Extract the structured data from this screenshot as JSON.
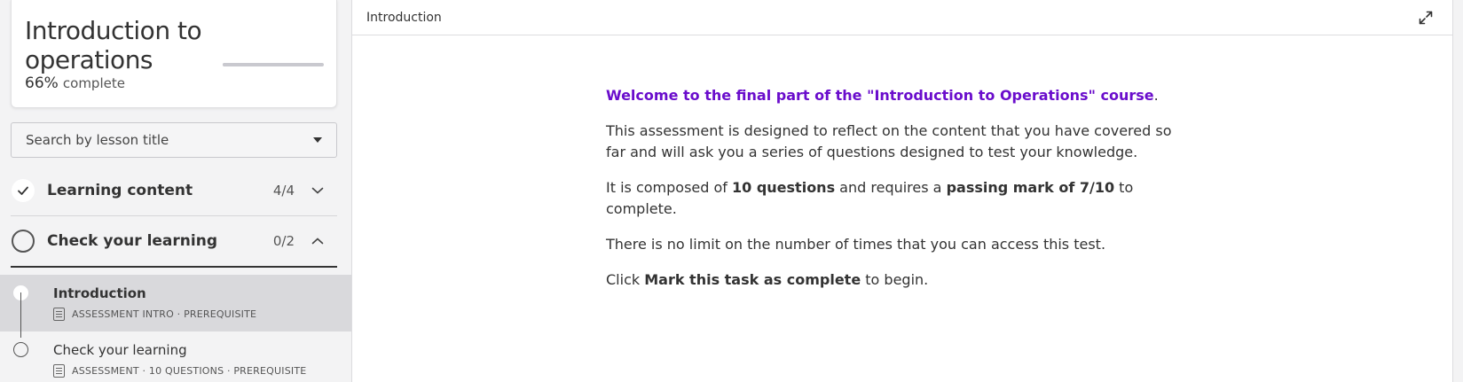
{
  "course": {
    "title": "Introduction to operations",
    "progress_percent": 66,
    "progress_pct_label": "66%",
    "progress_suffix": "complete"
  },
  "search": {
    "placeholder": "Search by lesson title"
  },
  "sections": [
    {
      "title": "Learning content",
      "count": "4/4",
      "status": "complete",
      "expanded": false
    },
    {
      "title": "Check your learning",
      "count": "0/2",
      "status": "incomplete",
      "expanded": true
    }
  ],
  "lessons": [
    {
      "title": "Introduction",
      "meta": "ASSESSMENT INTRO · PREREQUISITE",
      "active": true
    },
    {
      "title": "Check your learning",
      "meta": "ASSESSMENT · 10 QUESTIONS · PREREQUISITE",
      "active": false
    }
  ],
  "main": {
    "header_title": "Introduction",
    "welcome": "Welcome to the final part of the \"Introduction to Operations\" course",
    "welcome_end": ".",
    "para1": "This assessment is designed to reflect on the content that you have covered so far and will ask you a series of questions designed to test your knowledge.",
    "para2_a": "It is composed of ",
    "para2_b": "10 questions",
    "para2_c": " and requires a ",
    "para2_d": "passing mark of 7/10",
    "para2_e": " to complete.",
    "para3": "There is no limit on the number of times that you can access this test.",
    "para4_a": "Click ",
    "para4_b": "Mark this task as complete",
    "para4_c": " to begin."
  },
  "colors": {
    "accent": "#6a0dcc",
    "active_row": "#d9d9dc"
  },
  "icons": {
    "expand": "expand-icon",
    "check": "check-icon",
    "chevron_down": "chevron-down-icon",
    "chevron_up": "chevron-up-icon",
    "caret": "caret-down-icon"
  }
}
